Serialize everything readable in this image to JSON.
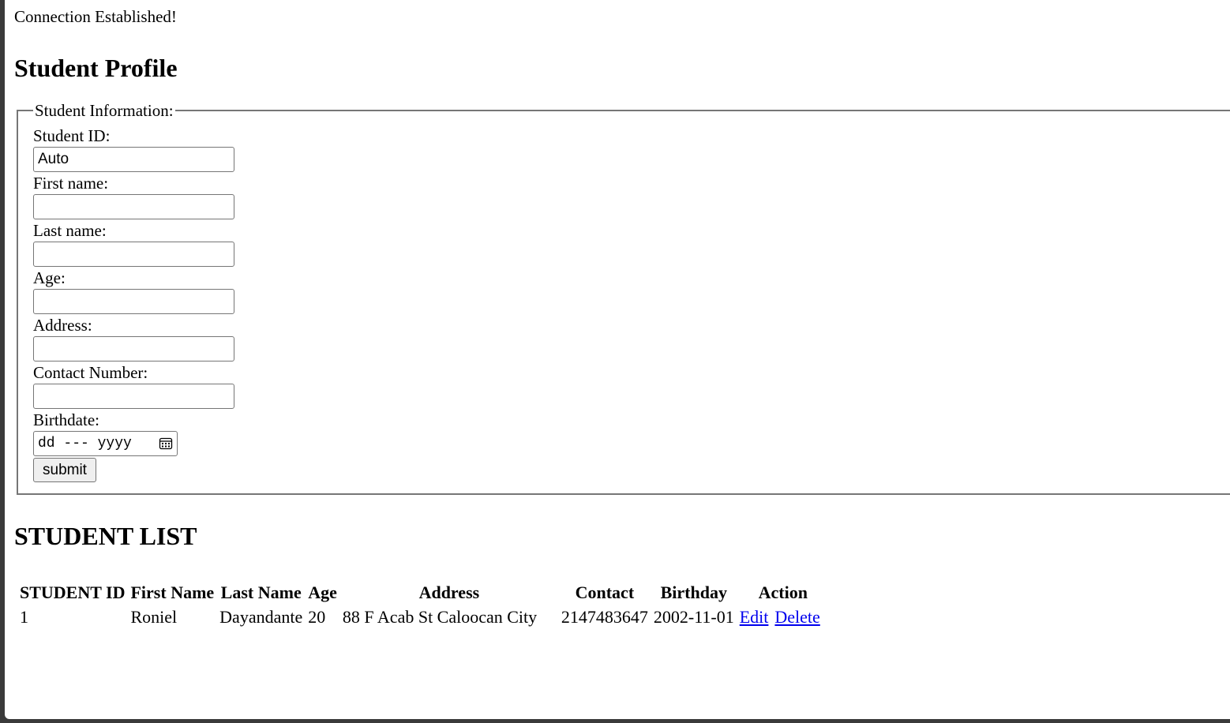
{
  "connection_message": "Connection Established!",
  "profile_title": "Student Profile",
  "form": {
    "legend": "Student Information:",
    "student_id": {
      "label": "Student ID:",
      "value": "Auto"
    },
    "first_name": {
      "label": "First name:",
      "value": ""
    },
    "last_name": {
      "label": "Last name:",
      "value": ""
    },
    "age": {
      "label": "Age:",
      "value": ""
    },
    "address": {
      "label": "Address:",
      "value": ""
    },
    "contact": {
      "label": "Contact Number:",
      "value": ""
    },
    "birthdate": {
      "label": "Birthdate:",
      "placeholder": "dd --- yyyy"
    },
    "submit_label": "submit"
  },
  "list_title": "STUDENT LIST",
  "table": {
    "headers": [
      "STUDENT ID",
      "First Name",
      "Last Name",
      "Age",
      "Address",
      "Contact",
      "Birthday",
      "Action"
    ],
    "rows": [
      {
        "id": "1",
        "first_name": "Roniel",
        "last_name": "Dayandante",
        "age": "20",
        "address": "88 F Acab St Caloocan City",
        "contact": "2147483647",
        "birthday": "2002-11-01",
        "edit_label": "Edit",
        "delete_label": "Delete"
      }
    ]
  },
  "colors": {
    "link": "#0000ee",
    "border": "#767676",
    "button_bg": "#efefef"
  },
  "icons": {
    "date_picker": "calendar-icon"
  }
}
